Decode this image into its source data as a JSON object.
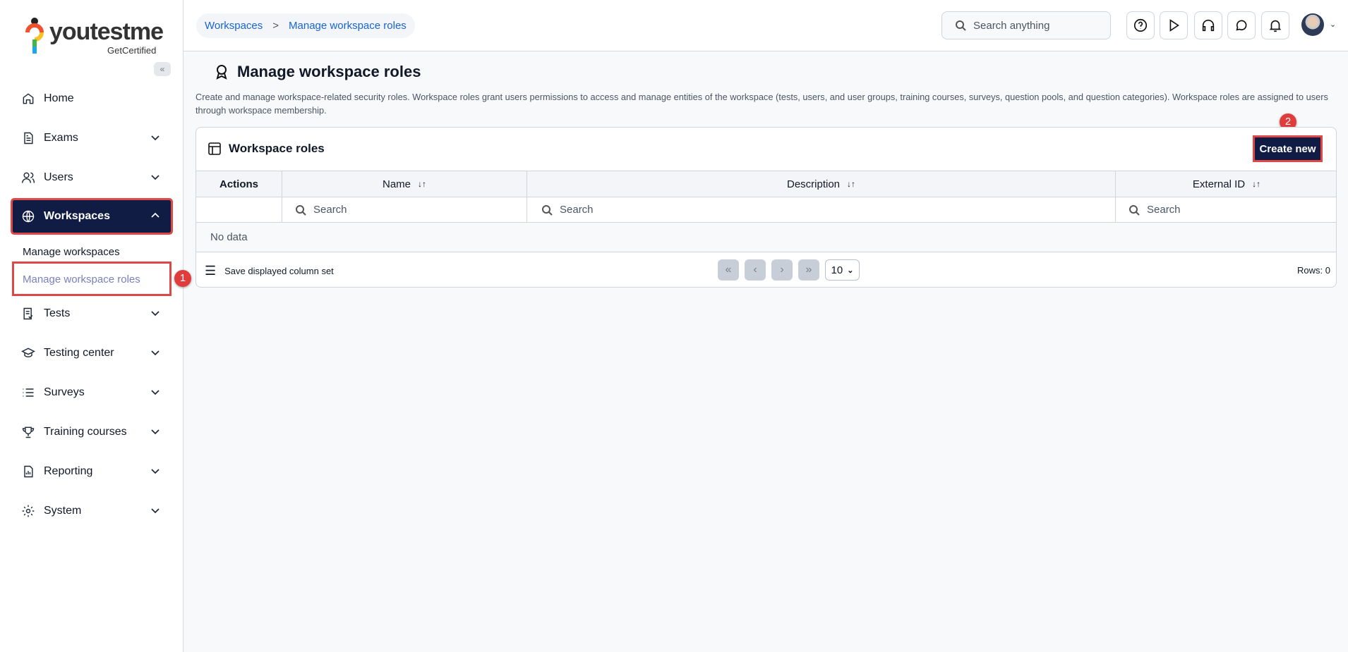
{
  "logo": {
    "word": "youtestme",
    "tagline": "GetCertified"
  },
  "sidebar": {
    "collapse_icon": "«",
    "items": [
      {
        "label": "Home",
        "icon": "home-icon"
      },
      {
        "label": "Exams",
        "icon": "document-icon"
      },
      {
        "label": "Users",
        "icon": "users-icon"
      },
      {
        "label": "Workspaces",
        "icon": "globe-icon",
        "expanded": true,
        "sub": [
          "Manage workspaces",
          "Manage workspace roles"
        ]
      },
      {
        "label": "Tests",
        "icon": "test-icon"
      },
      {
        "label": "Testing center",
        "icon": "graduation-cap-icon"
      },
      {
        "label": "Surveys",
        "icon": "list-icon"
      },
      {
        "label": "Training courses",
        "icon": "trophy-icon"
      },
      {
        "label": "Reporting",
        "icon": "report-icon"
      },
      {
        "label": "System",
        "icon": "gear-icon"
      }
    ]
  },
  "breadcrumb": {
    "items": [
      "Workspaces",
      "Manage workspace roles"
    ],
    "separator": ">"
  },
  "header": {
    "search_placeholder": "Search anything",
    "icons": [
      "help-icon",
      "play-icon",
      "headset-icon",
      "chat-icon",
      "bell-icon"
    ]
  },
  "page": {
    "title": "Manage workspace roles",
    "description": "Create and manage workspace-related security roles. Workspace roles grant users permissions to access and manage entities of the workspace (tests, users, and user groups, training courses, surveys, question pools, and question categories). Workspace roles are assigned to users through workspace membership."
  },
  "card": {
    "title": "Workspace roles",
    "create_label": "Create new",
    "columns": [
      "Actions",
      "Name",
      "Description",
      "External ID"
    ],
    "search_placeholder": "Search",
    "empty": "No data",
    "footer": {
      "save_label": "Save displayed column set",
      "page_size": "10",
      "rows": "Rows: 0",
      "first": "«",
      "prev": "‹",
      "next": "›",
      "last": "»"
    }
  },
  "annotations": [
    "1",
    "2"
  ],
  "colors": {
    "primary": "#111c45",
    "highlight": "#e04848",
    "link": "#1764d8"
  }
}
